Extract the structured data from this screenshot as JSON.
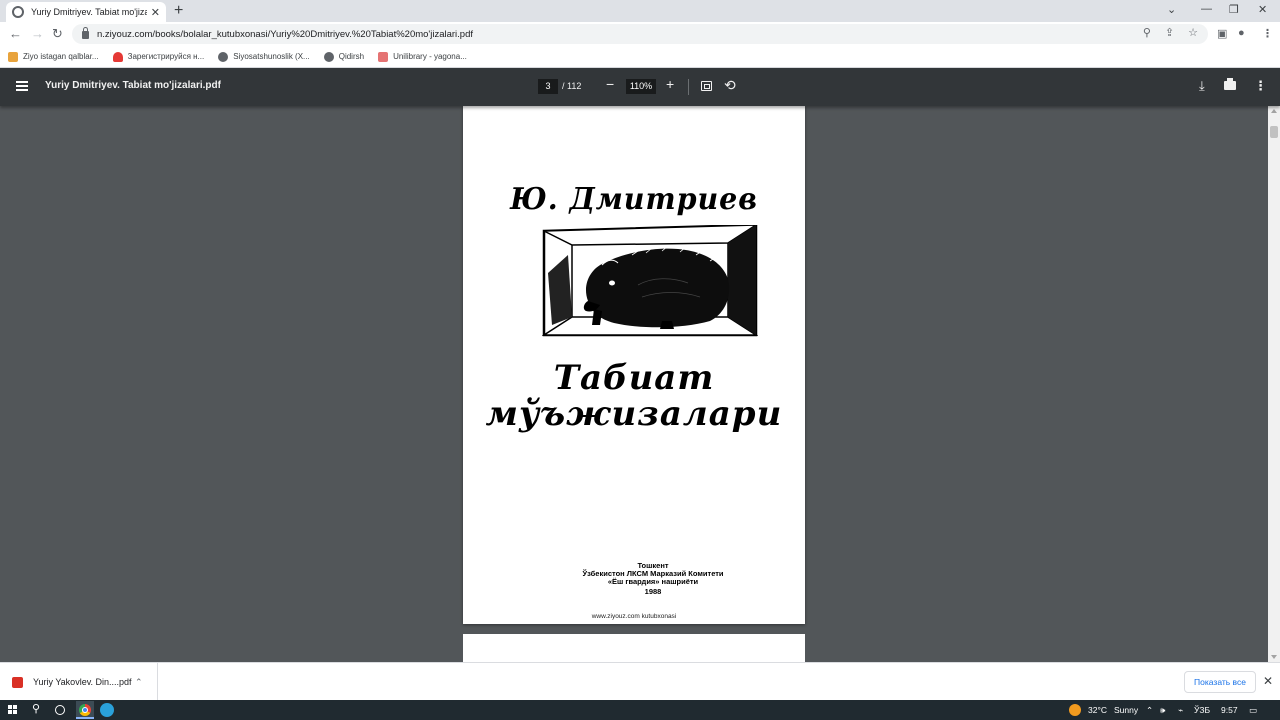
{
  "browser": {
    "tab_title": "Yuriy Dmitriyev. Tabiat mo'jizalari",
    "url": "n.ziyouz.com/books/bolalar_kutubxonasi/Yuriy%20Dmitriyev.%20Tabiat%20mo'jizalari.pdf"
  },
  "bookmarks": [
    {
      "label": "Ziyo istagan qalblar...",
      "color": "#e8a33c"
    },
    {
      "label": "Зарегистрируйся н...",
      "color": "#e53935"
    },
    {
      "label": "Siyosatshunoslik (X...",
      "color": "#5f6368"
    },
    {
      "label": "Qidirsh",
      "color": "#5f6368"
    },
    {
      "label": "Unilibrary - yagona...",
      "color": "#e57373"
    }
  ],
  "pdf_toolbar": {
    "title": "Yuriy Dmitriyev. Tabiat mo'jizalari.pdf",
    "current_page": "3",
    "total_pages": "/ 112",
    "zoom": "110%"
  },
  "cover": {
    "author": "Ю. Дмитриев",
    "title_line1": "Табиат",
    "title_line2": "мўъжизалари",
    "pub_city": "Тошкент",
    "pub_org": "Ўзбекистон ЛКСМ Марказий Комитети",
    "pub_house": "«Ёш гвардия» нашриёти",
    "pub_year": "1988",
    "footer": "www.ziyouz.com kutubxonasi"
  },
  "downloads": {
    "item_name": "Yuriy Yakovlev. Din....pdf",
    "show_all": "Показать все"
  },
  "taskbar": {
    "temperature": "32°C",
    "weather": "Sunny",
    "lang": "ЎЗБ",
    "time": "9:57"
  }
}
